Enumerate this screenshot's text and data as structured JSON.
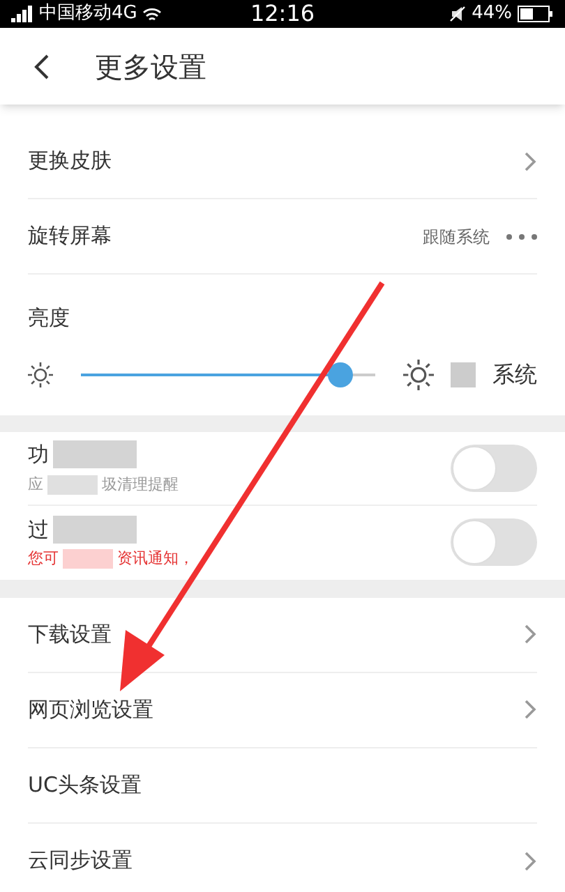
{
  "status_bar": {
    "carrier": "中国移动4G",
    "time": "12:16",
    "battery": "44%"
  },
  "header": {
    "title": "更多设置"
  },
  "rows_top": [
    {
      "kind": "link",
      "label": "更换皮肤"
    },
    {
      "kind": "value",
      "label": "旋转屏幕",
      "value": "跟随系统"
    }
  ],
  "brightness": {
    "label": "亮度",
    "level": 0.88,
    "system_label": "系统",
    "system_checked": false
  },
  "switch_rows": [
    {
      "title": "功",
      "subtitle_parts": [
        "应",
        "圾清理提醒"
      ],
      "subtitle_alert": false,
      "on": false
    },
    {
      "title": "过",
      "subtitle_parts": [
        "您可",
        "资讯通知，"
      ],
      "subtitle_alert": true,
      "on": false
    }
  ],
  "rows_bottom": [
    {
      "kind": "link",
      "label": "下载设置"
    },
    {
      "kind": "link",
      "label": "网页浏览设置"
    },
    {
      "kind": "plain",
      "label": "UC头条设置"
    },
    {
      "kind": "link",
      "label": "云同步设置"
    }
  ]
}
